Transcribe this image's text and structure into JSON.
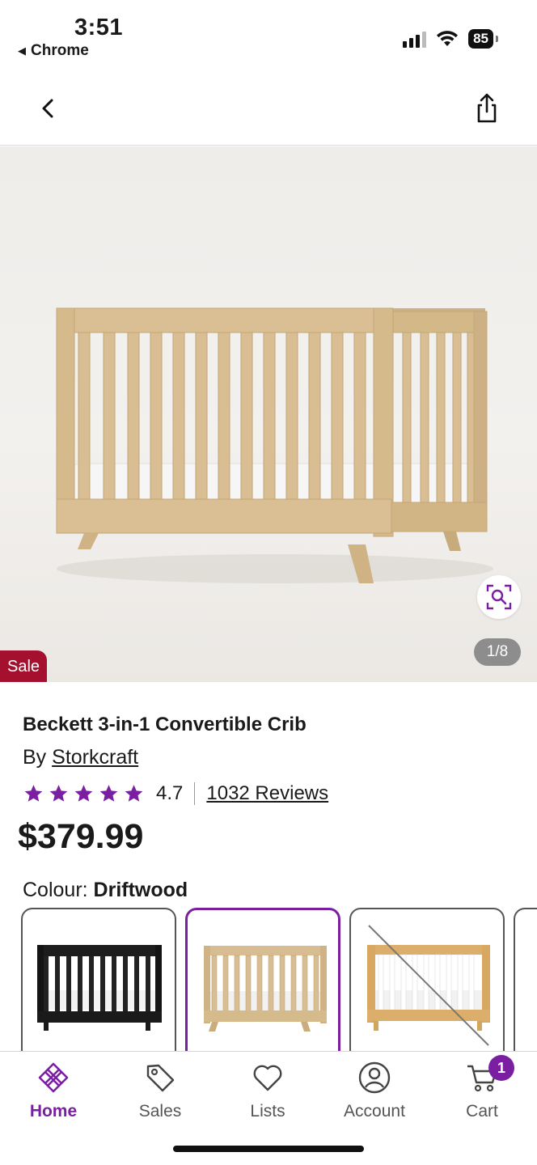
{
  "status_bar": {
    "time": "3:51",
    "back_app": "Chrome",
    "battery": "85"
  },
  "header": {
    "back_icon": "chevron-left-icon",
    "share_icon": "share-icon"
  },
  "gallery": {
    "counter": "1/8",
    "sale_badge": "Sale",
    "zoom_icon": "zoom-icon"
  },
  "product": {
    "title": "Beckett 3-in-1 Convertible Crib",
    "by_label": "By",
    "brand": "Storkcraft",
    "rating": "4.7",
    "stars": 5,
    "reviews": "1032 Reviews",
    "price": "$379.99",
    "colour_label": "Colour:",
    "colour_value": "Driftwood"
  },
  "swatches": [
    {
      "name": "black",
      "selected": false,
      "unavailable": false
    },
    {
      "name": "driftwood",
      "selected": true,
      "unavailable": false
    },
    {
      "name": "white-natural",
      "selected": false,
      "unavailable": true
    }
  ],
  "bottom_nav": {
    "items": [
      {
        "label": "Home",
        "icon": "home-logo-icon",
        "active": true
      },
      {
        "label": "Sales",
        "icon": "tag-icon",
        "active": false
      },
      {
        "label": "Lists",
        "icon": "heart-icon",
        "active": false
      },
      {
        "label": "Account",
        "icon": "account-icon",
        "active": false
      },
      {
        "label": "Cart",
        "icon": "cart-icon",
        "active": false
      }
    ],
    "cart_count": "1"
  },
  "colors": {
    "brand_purple": "#7b1fa2",
    "sale_red": "#a6102f",
    "wood": "#d6bb8c"
  }
}
